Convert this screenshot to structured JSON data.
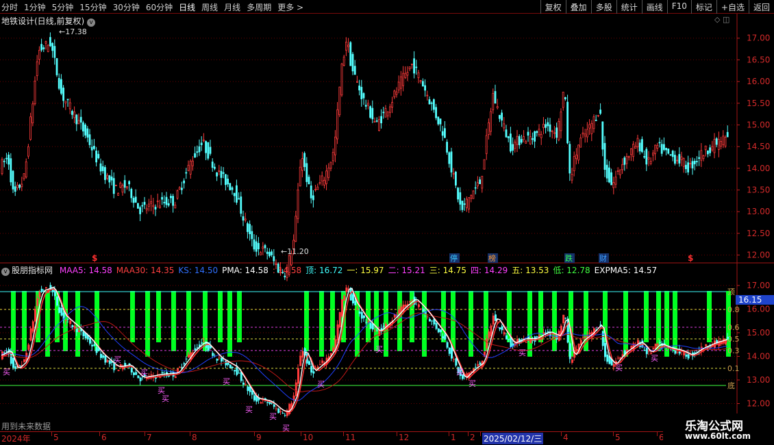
{
  "toolbar": {
    "periods": [
      "分时",
      "1分钟",
      "5分钟",
      "15分钟",
      "30分钟",
      "60分钟",
      "日线",
      "周线",
      "月线",
      "多周期",
      "更多 >"
    ],
    "active_period": "日线",
    "actions": [
      "复权",
      "叠加",
      "多股",
      "统计",
      "画线",
      "F10",
      "标记",
      "+自选",
      "返回"
    ]
  },
  "upper_chart": {
    "title": "地铁设计(日线,前复权)",
    "collapse_glyph": "v",
    "controls": "◇ ◫",
    "high_label": "17.38",
    "low_label": "11.20",
    "y_ticks": [
      "17.00",
      "16.50",
      "16.00",
      "15.50",
      "15.00",
      "14.50",
      "14.00",
      "13.50",
      "13.00",
      "12.50",
      "12.00"
    ],
    "event_markers": [
      {
        "text": "$",
        "color": "#ff3030"
      },
      {
        "text": "停",
        "color": "#38c8ff"
      },
      {
        "text": "榜",
        "color": "#ff9a30"
      },
      {
        "text": "跌",
        "color": "#30ff50"
      },
      {
        "text": "财",
        "color": "#3aa0ff"
      },
      {
        "text": "$",
        "color": "#ff3030"
      }
    ]
  },
  "lower_chart": {
    "indicator_name": "股朋指标网",
    "legend": [
      {
        "label": "MAA5: 14.58",
        "color": "#ff40ff"
      },
      {
        "label": "MAA30: 14.35",
        "color": "#ff4040"
      },
      {
        "label": "KS: 14.50",
        "color": "#3070ff"
      },
      {
        "label": "PMA: 14.58",
        "color": "#ffffff"
      },
      {
        "label": ": 14.58",
        "color": "#ff4040"
      },
      {
        "label": "顶: 16.72",
        "color": "#40ffff"
      },
      {
        "label": "一: 15.97",
        "color": "#ffff40"
      },
      {
        "label": "二: 15.21",
        "color": "#ff40ff"
      },
      {
        "label": "三: 14.75",
        "color": "#ffff40"
      },
      {
        "label": "四: 14.29",
        "color": "#ff40ff"
      },
      {
        "label": "五: 13.53",
        "color": "#ffff40"
      },
      {
        "label": "低: 12.78",
        "color": "#40ff40"
      },
      {
        "label": "EXPMA5: 14.57",
        "color": "#ffffff"
      }
    ],
    "y_ticks": [
      "17.00",
      "16.00",
      "15.00",
      "14.00",
      "13.00",
      "12.00"
    ],
    "level_labels": [
      "顶",
      "0.8",
      "0.6",
      "0.5",
      "0.3",
      "0.1",
      "底"
    ],
    "current_price": "16.15",
    "buy_label": "买",
    "future_note": "用到未来数据"
  },
  "time_axis": {
    "labels": [
      "2024年",
      "5",
      "6",
      "7",
      "8",
      "9",
      "10",
      "11",
      "12",
      "1",
      "2",
      "2025/02/12/三",
      "4",
      "5",
      "6"
    ]
  },
  "watermark": {
    "line1": "乐淘公式网",
    "line2": "www.60lt.com"
  },
  "colors": {
    "up": "#ff3b3b",
    "down": "#54ffff",
    "grid": "#6a0000",
    "bar_signal": "#00ff22",
    "top_line": "#40ffff",
    "bottom_line": "#40ff40"
  }
}
